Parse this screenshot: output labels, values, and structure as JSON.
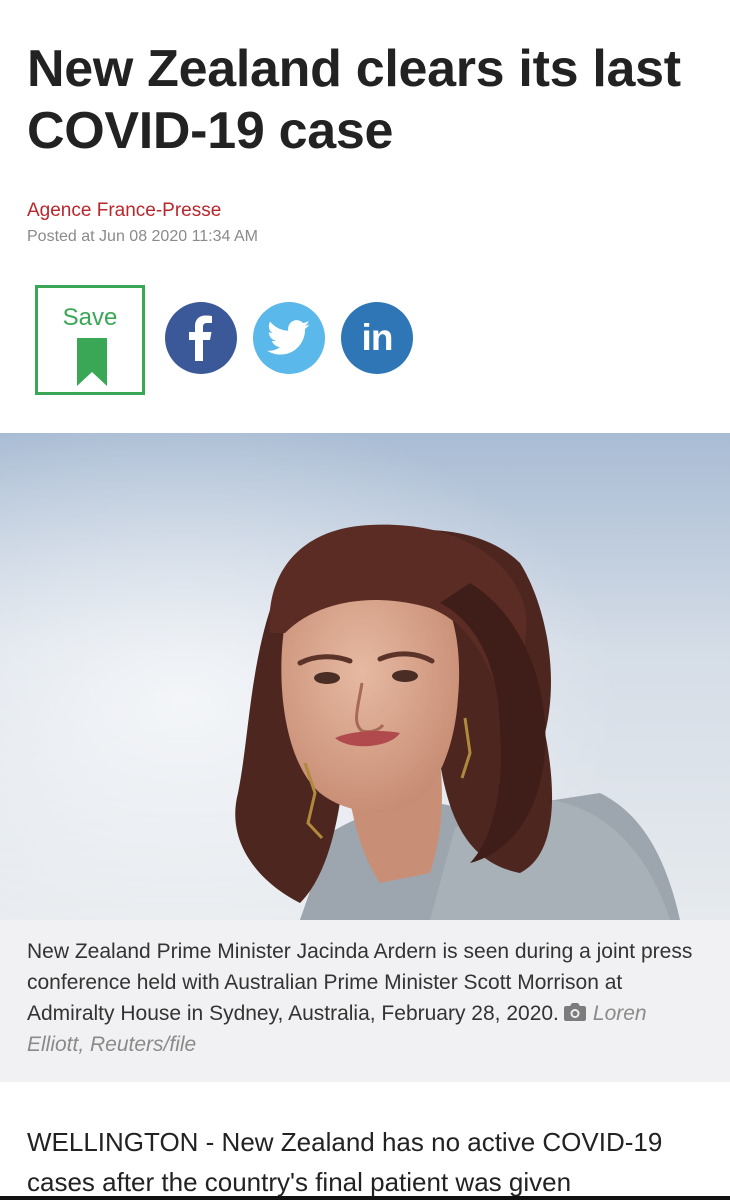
{
  "article": {
    "headline": "New Zealand clears its last COVID-19 case",
    "source": "Agence France-Presse",
    "posted": "Posted at Jun 08 2020 11:34 AM"
  },
  "actions": {
    "save_label": "Save",
    "linkedin_label": "in"
  },
  "photo": {
    "caption": "New Zealand Prime Minister Jacinda Ardern is seen during a joint press conference held with Australian Prime Minister Scott Morrison at Admiralty House in Sydney, Australia, February 28, 2020.",
    "credit": "Loren Elliott, Reuters/file"
  },
  "body": {
    "lead": "WELLINGTON - New Zealand has no active COVID-19 cases after the country's final patient was given"
  },
  "colors": {
    "source_red": "#b8272c",
    "save_green": "#3aa757",
    "facebook": "#3b5998",
    "twitter": "#5ab8ea",
    "linkedin": "#2e76b5"
  }
}
